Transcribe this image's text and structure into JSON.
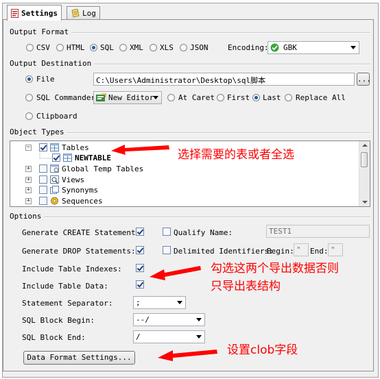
{
  "tabs": [
    {
      "label": "Settings",
      "active": true,
      "icon": "settings-doc-icon"
    },
    {
      "label": "Log",
      "active": false,
      "icon": "log-notepad-icon"
    }
  ],
  "output_format": {
    "title": "Output Format",
    "options": [
      "CSV",
      "HTML",
      "SQL",
      "XML",
      "XLS",
      "JSON"
    ],
    "selected": "SQL",
    "encoding_label": "Encoding:",
    "encoding_value": "GBK"
  },
  "output_destination": {
    "title": "Output Destination",
    "file_label": "File",
    "file_path": "C:\\Users\\Administrator\\Desktop\\sql脚本",
    "browse_label": "...",
    "sql_commander_label": "SQL Commander",
    "editor_value": "New Editor",
    "at_caret_label": "At Caret",
    "first_label": "First",
    "last_label": "Last",
    "replace_all_label": "Replace All",
    "clipboard_label": "Clipboard",
    "selected": "File",
    "position_selected": "Last"
  },
  "object_types": {
    "title": "Object Types",
    "items": [
      {
        "label": "Tables",
        "checked": true,
        "expanded": true
      },
      {
        "label": "NEWTABLE",
        "checked": true,
        "child": true
      },
      {
        "label": "Global Temp Tables",
        "checked": false
      },
      {
        "label": "Views",
        "checked": false
      },
      {
        "label": "Synonyms",
        "checked": false
      },
      {
        "label": "Sequences",
        "checked": false
      }
    ]
  },
  "options": {
    "title": "Options",
    "generate_create_label": "Generate CREATE Statements:",
    "generate_create": true,
    "generate_drop_label": "Generate DROP Statements:",
    "generate_drop": true,
    "include_indexes_label": "Include Table Indexes:",
    "include_indexes": true,
    "include_data_label": "Include Table Data:",
    "include_data": true,
    "statement_separator_label": "Statement Separator:",
    "statement_separator": ";",
    "sql_block_begin_label": "SQL Block Begin:",
    "sql_block_begin": "--/",
    "sql_block_end_label": "SQL Block End:",
    "sql_block_end": "/",
    "qualify_name_label": "Qualify Name:",
    "qualify_name_value": "TEST1",
    "delimited_label": "Delimited Identifiers:",
    "begin_label": "Begin:",
    "end_label": "End:",
    "begin_value": "\"",
    "end_value": "\"",
    "data_format_button": "Data Format Settings..."
  },
  "annotations": {
    "select_tables": "选择需要的表或者全选",
    "export_data_line1": "勾选这两个导出数据否则",
    "export_data_line2": "只导出表结构",
    "clob": "设置clob字段"
  },
  "colors": {
    "annotation": "#ff0000",
    "radio_selected": "#1e5aa8"
  }
}
